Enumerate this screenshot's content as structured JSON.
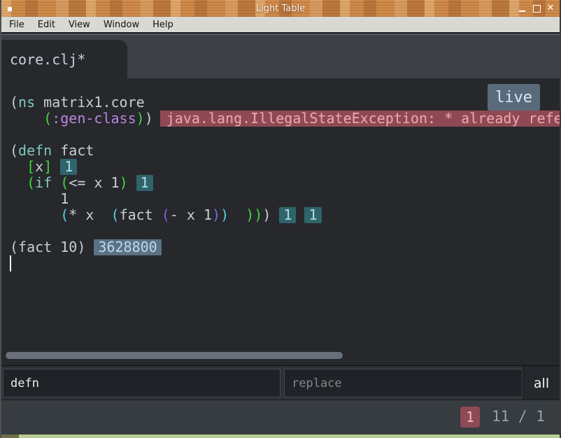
{
  "window": {
    "title": "Light Table"
  },
  "menu": {
    "items": [
      "File",
      "Edit",
      "View",
      "Window",
      "Help"
    ]
  },
  "tabs": {
    "active_label": "core.clj*"
  },
  "editor": {
    "live_button_label": "live",
    "lines": [
      {
        "segments": [
          [
            "(",
            "plain"
          ],
          [
            "ns",
            "keyword"
          ],
          [
            " matrix1.core",
            "plain"
          ]
        ]
      },
      {
        "segments": [
          [
            "    ",
            "plain"
          ],
          [
            "(",
            "green"
          ],
          [
            ":gen-class",
            "purple"
          ],
          [
            ")",
            "green"
          ],
          [
            ")",
            "plain"
          ]
        ],
        "error": "java.lang.IllegalStateException: * already refe"
      },
      {
        "segments": []
      },
      {
        "segments": [
          [
            "(",
            "plain"
          ],
          [
            "defn",
            "keyword"
          ],
          [
            " fact",
            "plain"
          ]
        ]
      },
      {
        "segments": [
          [
            "  ",
            "plain"
          ],
          [
            "[",
            "green"
          ],
          [
            "x",
            "plain"
          ],
          [
            "]",
            "green"
          ],
          [
            " ",
            "plain"
          ]
        ],
        "badges": [
          {
            "text": "1",
            "style": "teal"
          }
        ]
      },
      {
        "segments": [
          [
            "  ",
            "plain"
          ],
          [
            "(",
            "green"
          ],
          [
            "if",
            "keyword"
          ],
          [
            " ",
            "plain"
          ],
          [
            "(",
            "green"
          ],
          [
            "<= x 1",
            "plain"
          ],
          [
            ")",
            "green"
          ],
          [
            " ",
            "plain"
          ]
        ],
        "badges": [
          {
            "text": "1",
            "style": "teal"
          }
        ]
      },
      {
        "segments": [
          [
            "      1",
            "plain"
          ]
        ]
      },
      {
        "segments": [
          [
            "      ",
            "plain"
          ],
          [
            "(",
            "cyan"
          ],
          [
            "* x  ",
            "plain"
          ],
          [
            "(",
            "cyan"
          ],
          [
            "fact ",
            "plain"
          ],
          [
            "(",
            "blueviolet"
          ],
          [
            "- x 1",
            "plain"
          ],
          [
            ")",
            "blueviolet"
          ],
          [
            ")",
            "cyan"
          ],
          [
            "  ",
            "plain"
          ],
          [
            "))",
            "green"
          ],
          [
            ")",
            "plain"
          ],
          [
            " ",
            "plain"
          ]
        ],
        "badges": [
          {
            "text": "1",
            "style": "teal"
          },
          {
            "text": "1",
            "style": "teal"
          }
        ]
      },
      {
        "segments": []
      },
      {
        "segments": [
          [
            "(fact 10) ",
            "plain"
          ]
        ],
        "badges": [
          {
            "text": "3628800",
            "style": "blue"
          }
        ]
      },
      {
        "segments": [],
        "cursor": true
      }
    ]
  },
  "find_bar": {
    "search_value": "defn",
    "replace_placeholder": "replace",
    "all_label": "all"
  },
  "status": {
    "current_match": "1",
    "match_count": "11 / 1"
  },
  "colors": {
    "tokens": {
      "plain": "#c9ced3",
      "keyword": "#7fc9bd",
      "green": "#3fd93f",
      "cyan": "#52d2e4",
      "purple": "#bb86dc",
      "blueviolet": "#7a63e0"
    },
    "badge_teal_bg": "#31636b",
    "badge_teal_fg": "#a9e2e4",
    "badge_blue_bg": "#5c7182",
    "badge_blue_fg": "#b5daf5",
    "error_bg": "#8e4a54",
    "error_fg": "#f2a6ad",
    "live_bg": "#5a6a7b",
    "live_fg": "#d6e9fb",
    "match_badge_bg": "#8e4a55",
    "match_badge_fg": "#f2b9bd"
  }
}
